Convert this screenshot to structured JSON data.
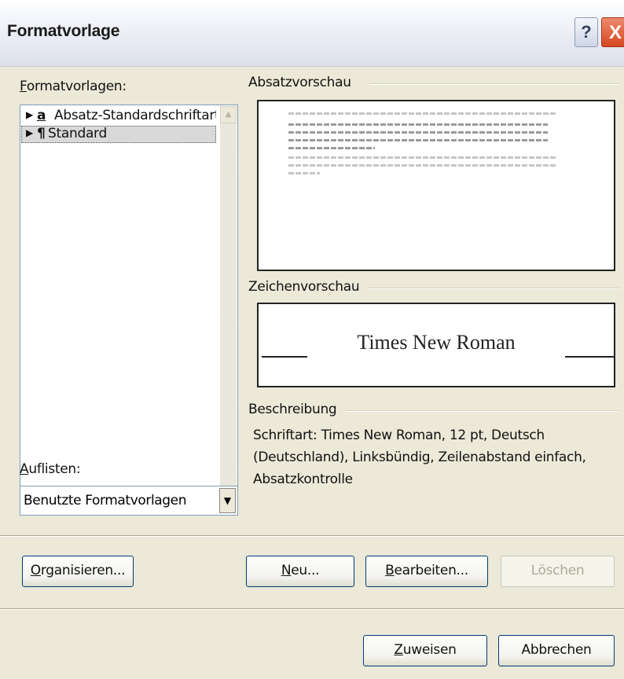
{
  "window": {
    "title": "Formatvorlage",
    "help_glyph": "?",
    "close_glyph": "X"
  },
  "styles_panel": {
    "label_first": "F",
    "label_rest": "ormatvorlagen:",
    "items": [
      {
        "glyph": "a",
        "label": "Absatz-Standardschriftart",
        "type": "character"
      },
      {
        "glyph": "¶",
        "label": "Standard",
        "type": "paragraph",
        "selected": true
      }
    ]
  },
  "list_filter": {
    "label_first": "A",
    "label_rest": "uflisten:",
    "value": "Benutzte Formatvorlagen"
  },
  "paragraph_preview": {
    "label": "Absatzvorschau"
  },
  "character_preview": {
    "label": "Zeichenvorschau",
    "font_sample": "Times New Roman"
  },
  "description": {
    "label": "Beschreibung",
    "text": "Schriftart: Times New Roman, 12 pt, Deutsch\n(Deutschland), Linksbündig, Zeilenabstand einfach,\nAbsatzkontrolle"
  },
  "buttons": {
    "organize": {
      "first": "O",
      "rest": "rganisieren..."
    },
    "new": {
      "first": "N",
      "rest": "eu..."
    },
    "edit": {
      "first": "B",
      "rest": "earbeiten..."
    },
    "delete": {
      "label": "Löschen"
    },
    "apply": {
      "first": "Z",
      "rest": "uweisen"
    },
    "cancel": {
      "label": "Abbrechen"
    }
  }
}
